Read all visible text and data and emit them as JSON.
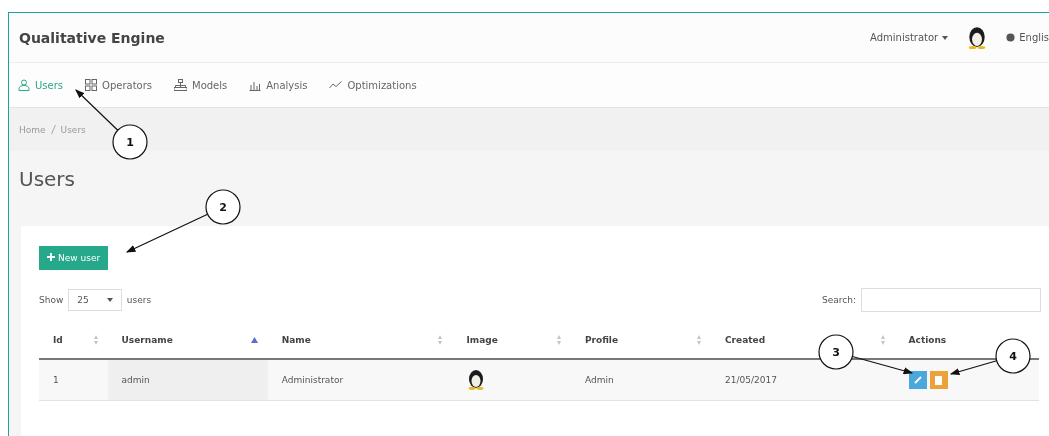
{
  "header": {
    "brand": "Qualitative Engine",
    "user_menu": "Administrator",
    "language": "Englis"
  },
  "nav": [
    {
      "label": "Users",
      "selected": true
    },
    {
      "label": "Operators",
      "selected": false
    },
    {
      "label": "Models",
      "selected": false
    },
    {
      "label": "Analysis",
      "selected": false
    },
    {
      "label": "Optimizations",
      "selected": false
    }
  ],
  "breadcrumb": [
    "Home",
    "Users"
  ],
  "page_title": "Users",
  "new_button": "New user",
  "length_control": {
    "before": "Show",
    "value": "25",
    "after": "users"
  },
  "search": {
    "label": "Search:"
  },
  "table": {
    "columns": [
      {
        "label": "Id",
        "sortable": true,
        "sorted": false
      },
      {
        "label": "Username",
        "sortable": true,
        "sorted": true
      },
      {
        "label": "Name",
        "sortable": true,
        "sorted": false
      },
      {
        "label": "Image",
        "sortable": true,
        "sorted": false
      },
      {
        "label": "Profile",
        "sortable": true,
        "sorted": false
      },
      {
        "label": "Created",
        "sortable": true,
        "sorted": false
      },
      {
        "label": "Actions",
        "sortable": false
      }
    ],
    "rows": [
      {
        "id": "1",
        "username": "admin",
        "name": "Administrator",
        "profile": "Admin",
        "created": "21/05/2017"
      }
    ]
  },
  "callouts": [
    "1",
    "2",
    "3",
    "4"
  ]
}
